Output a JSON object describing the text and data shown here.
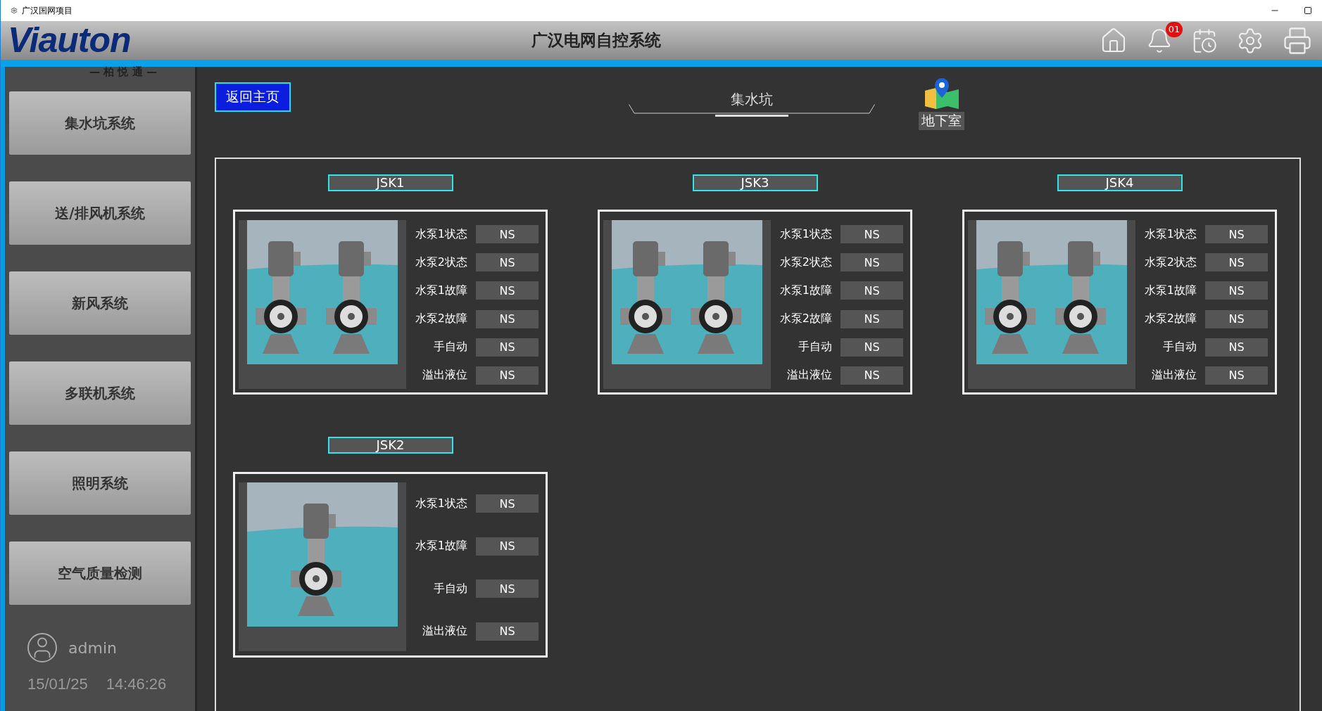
{
  "window": {
    "title": "广汉国网项目"
  },
  "header": {
    "logo": "Viauton",
    "logo_subtitle": "— 柏 悦 通 —",
    "title": "广汉电网自控系统",
    "notification_count": "01"
  },
  "sidebar": {
    "items": [
      {
        "label": "集水坑系统",
        "selected": false
      },
      {
        "label": "送/排风机系统",
        "selected": false
      },
      {
        "label": "新风系统",
        "selected": false
      },
      {
        "label": "多联机系统",
        "selected": false
      },
      {
        "label": "照明系统",
        "selected": false
      },
      {
        "label": "空气质量检测",
        "selected": false
      }
    ],
    "user": "admin",
    "date": "15/01/25",
    "time": "14:46:26"
  },
  "back_button": "返回主页",
  "tab": {
    "label": "集水坑",
    "selected": true
  },
  "location": {
    "label": "地下室"
  },
  "units": [
    {
      "name": "JSK1",
      "pumps": [
        {
          "kind": "pump"
        },
        {
          "kind": "pump"
        }
      ],
      "rows": [
        {
          "label": "水泵1状态",
          "value": "NS"
        },
        {
          "label": "水泵2状态",
          "value": "NS"
        },
        {
          "label": "水泵1故障",
          "value": "NS"
        },
        {
          "label": "水泵2故障",
          "value": "NS"
        },
        {
          "label": "手自动",
          "value": "NS"
        },
        {
          "label": "溢出液位",
          "value": "NS"
        }
      ]
    },
    {
      "name": "JSK3",
      "pumps": [
        {
          "kind": "pump"
        },
        {
          "kind": "pump"
        }
      ],
      "rows": [
        {
          "label": "水泵1状态",
          "value": "NS"
        },
        {
          "label": "水泵2状态",
          "value": "NS"
        },
        {
          "label": "水泵1故障",
          "value": "NS"
        },
        {
          "label": "水泵2故障",
          "value": "NS"
        },
        {
          "label": "手自动",
          "value": "NS"
        },
        {
          "label": "溢出液位",
          "value": "NS"
        }
      ]
    },
    {
      "name": "JSK4",
      "pumps": [
        {
          "kind": "pump"
        },
        {
          "kind": "pump"
        }
      ],
      "rows": [
        {
          "label": "水泵1状态",
          "value": "NS"
        },
        {
          "label": "水泵2状态",
          "value": "NS"
        },
        {
          "label": "水泵1故障",
          "value": "NS"
        },
        {
          "label": "水泵2故障",
          "value": "NS"
        },
        {
          "label": "手自动",
          "value": "NS"
        },
        {
          "label": "溢出液位",
          "value": "NS"
        }
      ]
    },
    {
      "name": "JSK2",
      "pumps": [
        {
          "kind": "pump"
        }
      ],
      "rows": [
        {
          "label": "水泵1状态",
          "value": "NS"
        },
        {
          "label": "水泵1故障",
          "value": "NS"
        },
        {
          "label": "手自动",
          "value": "NS"
        },
        {
          "label": "溢出液位",
          "value": "NS"
        }
      ]
    }
  ]
}
